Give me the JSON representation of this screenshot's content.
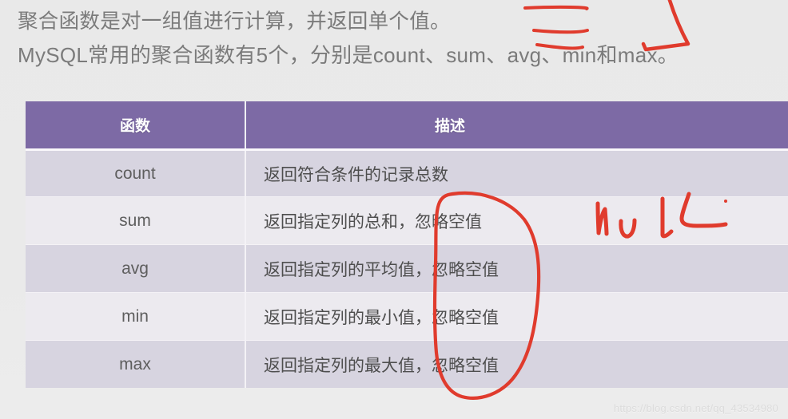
{
  "intro": {
    "line1": "聚合函数是对一组值进行计算，并返回单个值。",
    "line2": "MySQL常用的聚合函数有5个，分别是count、sum、avg、min和max。"
  },
  "table": {
    "headers": {
      "function": "函数",
      "description": "描述"
    },
    "rows": [
      {
        "function": "count",
        "description": "返回符合条件的记录总数"
      },
      {
        "function": "sum",
        "description": "返回指定列的总和，忽略空值"
      },
      {
        "function": "avg",
        "description": "返回指定列的平均值，忽略空值"
      },
      {
        "function": "min",
        "description": "返回指定列的最小值，忽略空值"
      },
      {
        "function": "max",
        "description": "返回指定列的最大值，忽略空值"
      }
    ]
  },
  "annotations": {
    "ink_color": "#e03b2d",
    "handwritten_null": "NULL",
    "marks": [
      "underline-stroke-1",
      "underline-stroke-2",
      "underline-stroke-3",
      "checkmark-over-min",
      "ellipse-around-ignore-null-column",
      "handwritten-null-text"
    ]
  },
  "watermark": {
    "text": "https://blog.csdn.net/qq_43534980"
  },
  "colors": {
    "background": "#e9e9e9",
    "header_purple": "#7d6aa5",
    "row_odd": "#d7d4e0",
    "row_even": "#eceaef",
    "text_gray": "#7b7b7b",
    "ink_red": "#e03b2d"
  }
}
